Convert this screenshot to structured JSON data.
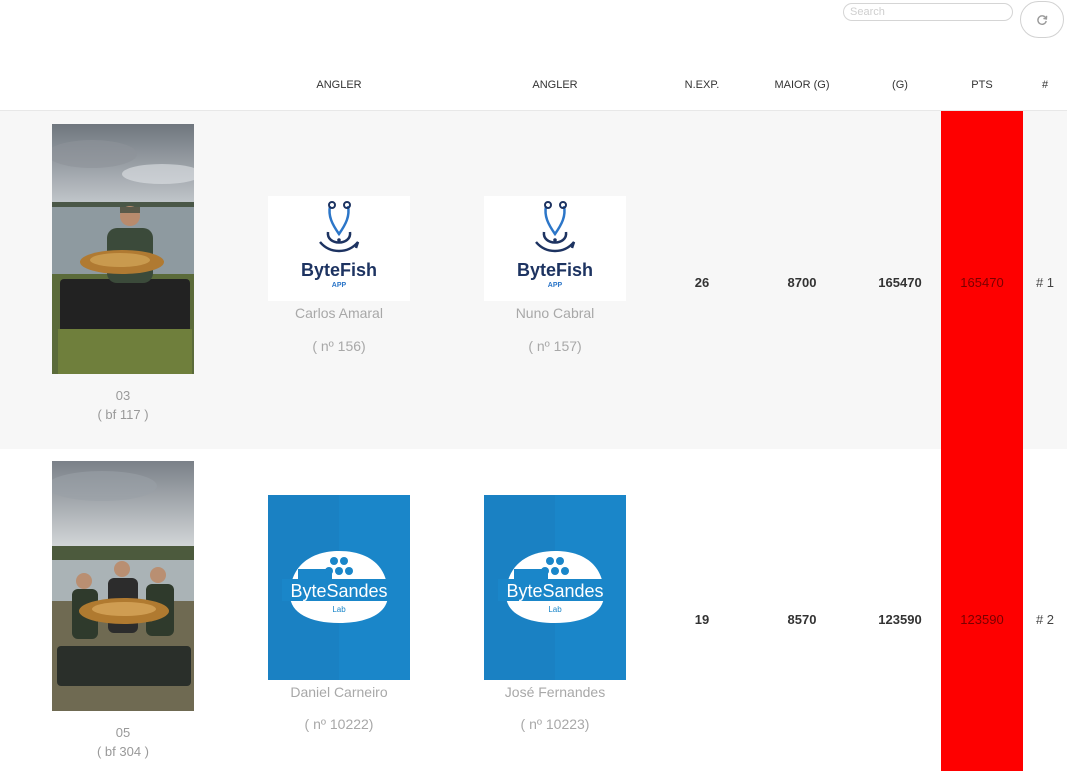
{
  "toolbar": {
    "search_placeholder": "Search",
    "refresh_icon": "refresh-icon"
  },
  "table": {
    "headers": [
      "ANGLER",
      "ANGLER",
      "N.EXP.",
      "MAIOR (G)",
      "(G)",
      "PTS",
      "#"
    ],
    "rows": [
      {
        "team_number": "03",
        "team_code": "( bf 117 )",
        "angler1": {
          "logo": "ByteFish",
          "logo_sub": "APP",
          "name": "Carlos Amaral",
          "number": "( nº 156)"
        },
        "angler2": {
          "logo": "ByteFish",
          "logo_sub": "APP",
          "name": "Nuno Cabral",
          "number": "( nº 157)"
        },
        "n_exp": "26",
        "maior": "8700",
        "total_g": "165470",
        "pts": "165470",
        "rank": "# 1"
      },
      {
        "team_number": "05",
        "team_code": "( bf 304 )",
        "angler1": {
          "logo": "ByteSandes",
          "logo_sub": "Lab",
          "name": "Daniel Carneiro",
          "number": "( nº 10222)"
        },
        "angler2": {
          "logo": "ByteSandes",
          "logo_sub": "Lab",
          "name": "José Fernandes",
          "number": "( nº 10223)"
        },
        "n_exp": "19",
        "maior": "8570",
        "total_g": "123590",
        "pts": "123590",
        "rank": "# 2"
      }
    ]
  },
  "colors": {
    "pts_highlight": "#fe0000",
    "bytefish_navy": "#1d3361",
    "bytesandes_blue": "#1a86c9"
  }
}
